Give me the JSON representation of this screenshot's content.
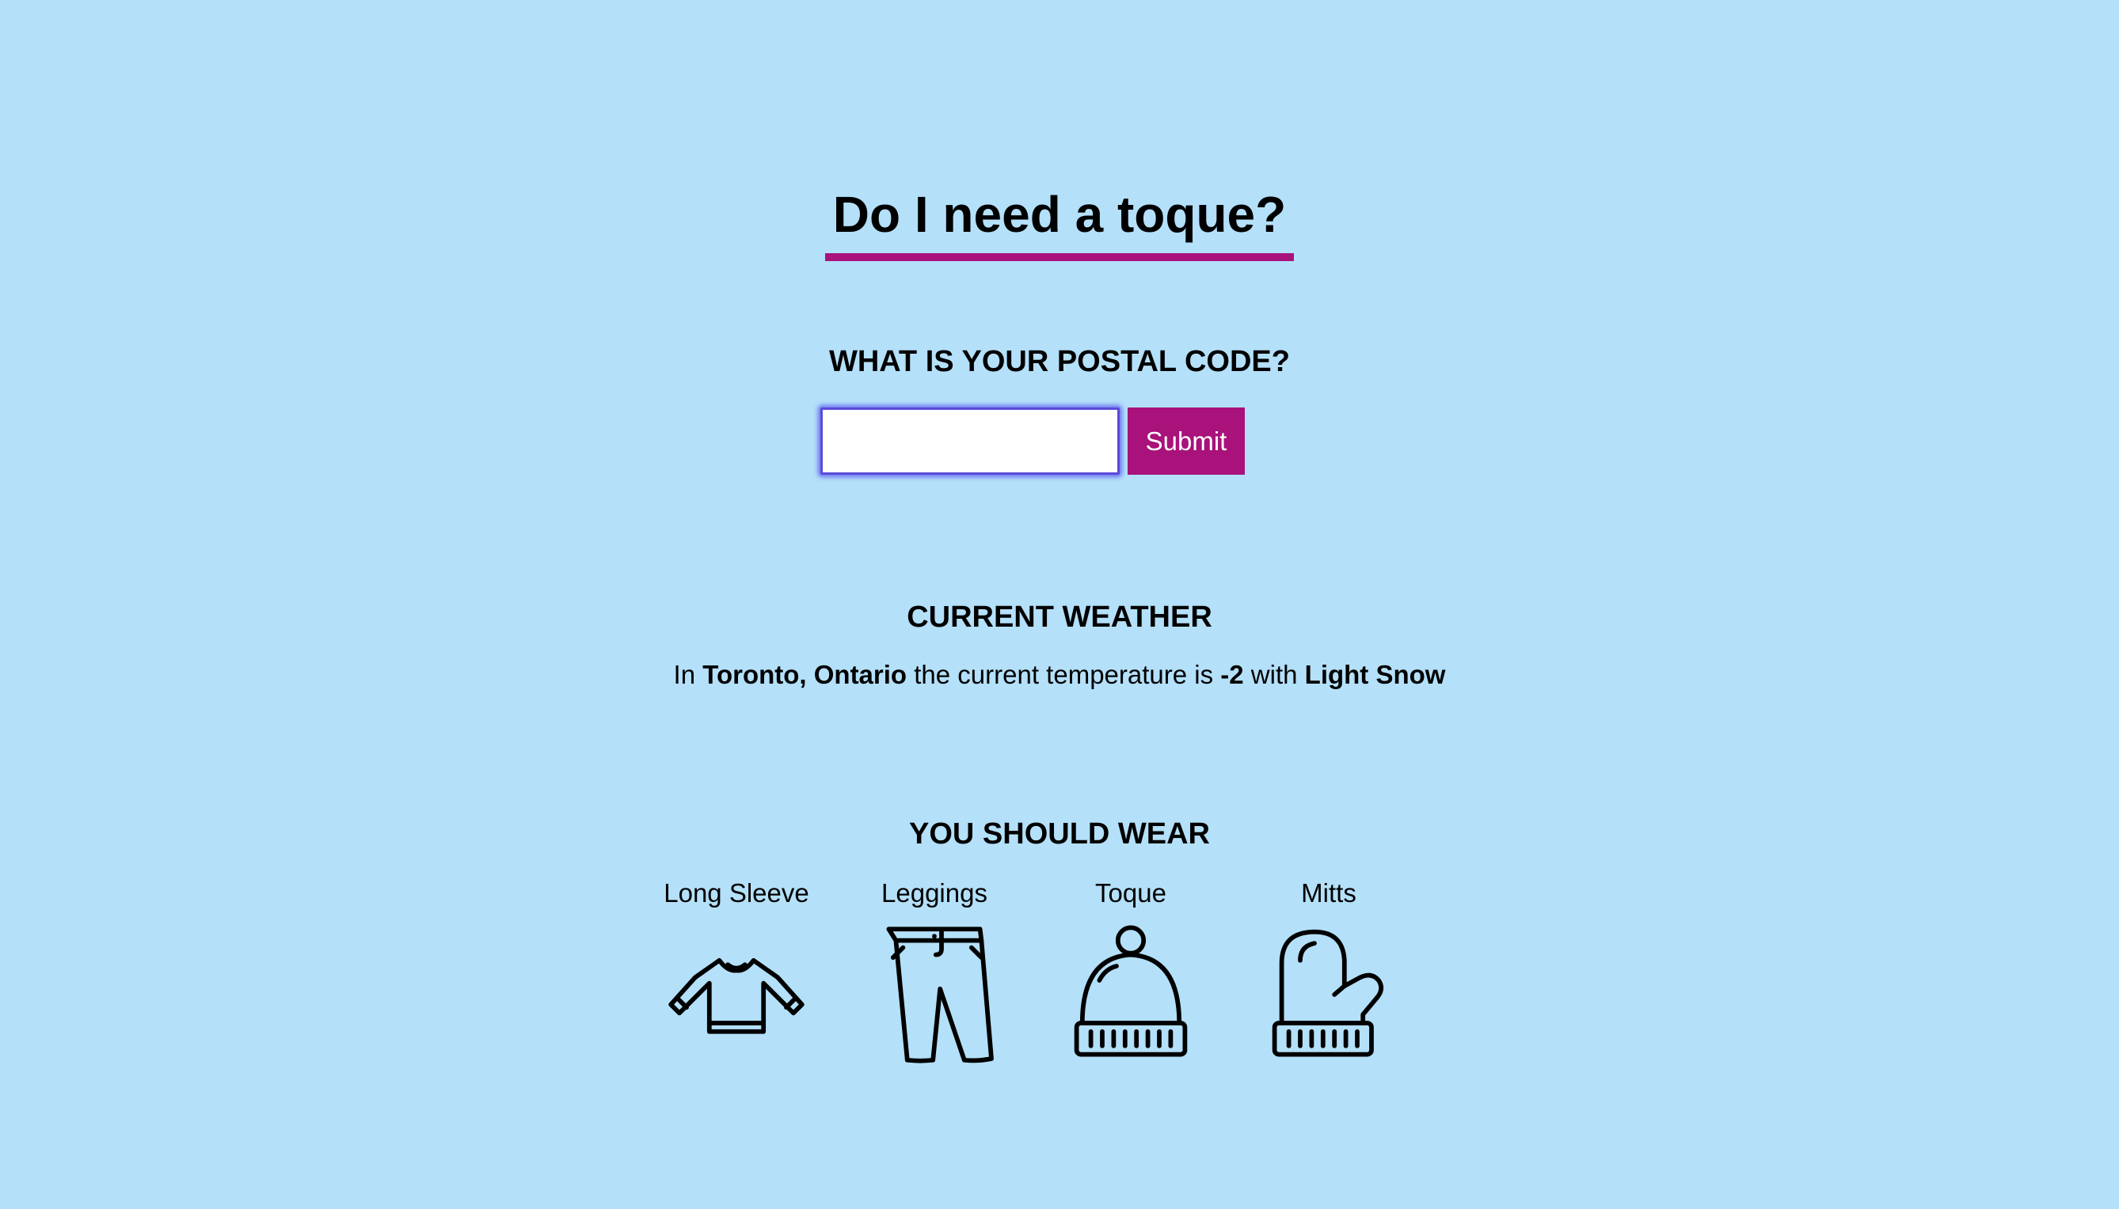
{
  "header": {
    "title": "Do I need a toque?"
  },
  "postal": {
    "heading": "WHAT IS YOUR POSTAL CODE?",
    "input_value": "",
    "submit_label": "Submit"
  },
  "weather": {
    "heading": "CURRENT WEATHER",
    "prefix": "In",
    "location": "Toronto, Ontario",
    "middle": "the current temperature is",
    "temperature": "-2",
    "connector": "with",
    "condition": "Light Snow"
  },
  "wear": {
    "heading": "YOU SHOULD WEAR",
    "items": [
      {
        "label": "Long Sleeve",
        "icon": "long-sleeve-shirt-icon"
      },
      {
        "label": "Leggings",
        "icon": "pants-icon"
      },
      {
        "label": "Toque",
        "icon": "toque-icon"
      },
      {
        "label": "Mitts",
        "icon": "mitten-icon"
      }
    ]
  },
  "colors": {
    "background": "#b4e0f9",
    "accent": "#a8127a",
    "input_focus": "#5b4bd8"
  }
}
